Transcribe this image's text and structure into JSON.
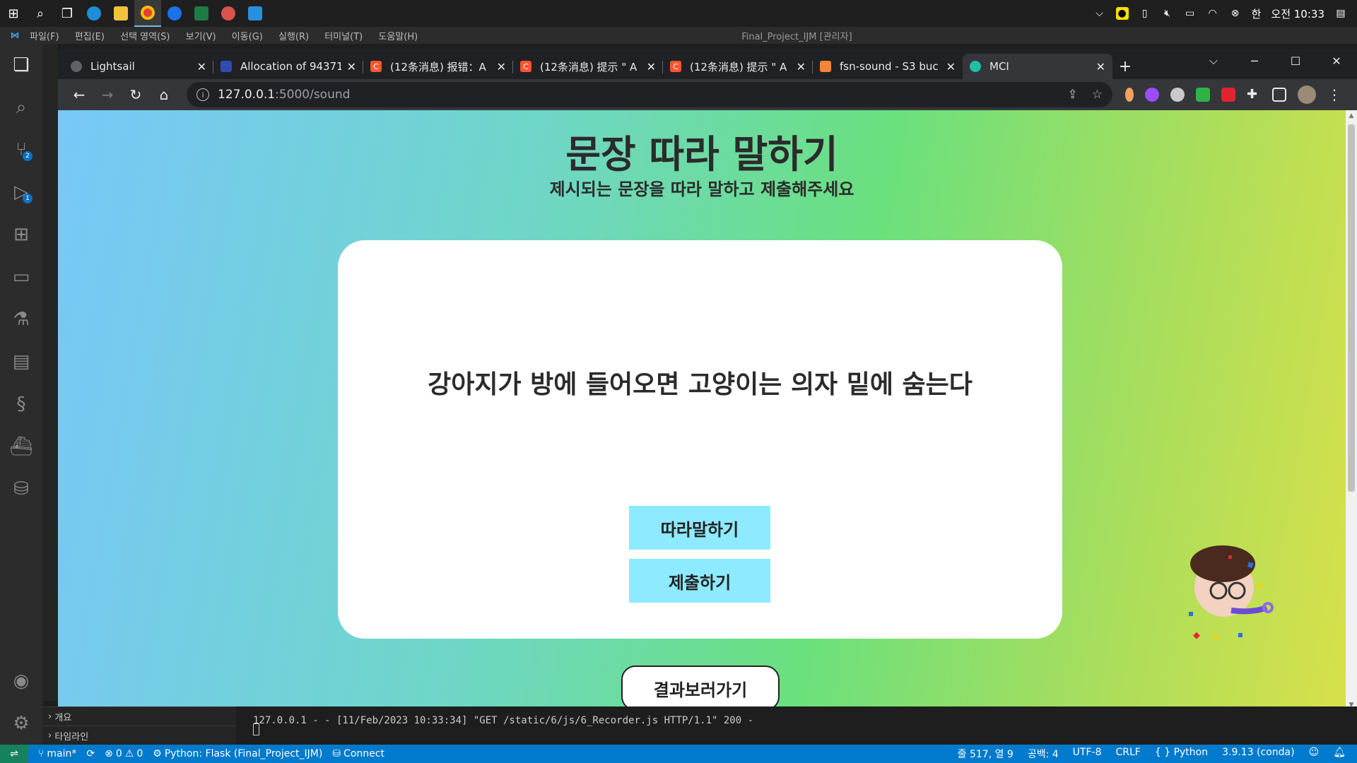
{
  "taskbar": {
    "tray": {
      "ime": "한",
      "time": "오전 10:33"
    }
  },
  "vscode": {
    "menu": [
      "파일(F)",
      "편집(E)",
      "선택 영역(S)",
      "보기(V)",
      "이동(G)",
      "실행(R)",
      "터미널(T)",
      "도움말(H)"
    ],
    "window_title": "Final_Project_IJM [관리자]",
    "badges": {
      "source_control": "2",
      "run_debug": "1"
    },
    "outline_label": "개요",
    "timeline_label": "타임라인",
    "terminal_line": "127.0.0.1 - - [11/Feb/2023 10:33:34] \"GET /static/6/js/6_Recorder.js HTTP/1.1\" 200 -",
    "status": {
      "branch": "main*",
      "errors": "0",
      "warnings": "0",
      "debug": "Python: Flask (Final_Project_IJM)",
      "connect": "Connect",
      "position": "줄 517, 열 9",
      "spaces": "공백: 4",
      "encoding": "UTF-8",
      "eol": "CRLF",
      "language": "Python",
      "interpreter": "3.9.13 (conda)"
    }
  },
  "chrome": {
    "tabs": [
      {
        "title": "Lightsail",
        "color": "#5f6368"
      },
      {
        "title": "Allocation of 94371",
        "color": "#2f4db0"
      },
      {
        "title": "(12条消息) 报错：A",
        "color": "#fc5531"
      },
      {
        "title": "(12条消息) 提示 \" A",
        "color": "#fc5531"
      },
      {
        "title": "(12条消息) 提示 \" A",
        "color": "#fc5531"
      },
      {
        "title": "fsn-sound - S3 buc",
        "color": "#f58536"
      },
      {
        "title": "MCI",
        "color": "#1fbfa6"
      }
    ],
    "url_host": "127.0.0.1",
    "url_path": ":5000/sound"
  },
  "page": {
    "title": "문장 따라 말하기",
    "subtitle": "제시되는 문장을 따라 말하고 제출해주세요",
    "sentence": "강아지가 방에 들어오면 고양이는 의자 밑에 숨는다",
    "repeat_button": "따라말하기",
    "submit_button": "제출하기",
    "result_button": "결과보러가기"
  }
}
